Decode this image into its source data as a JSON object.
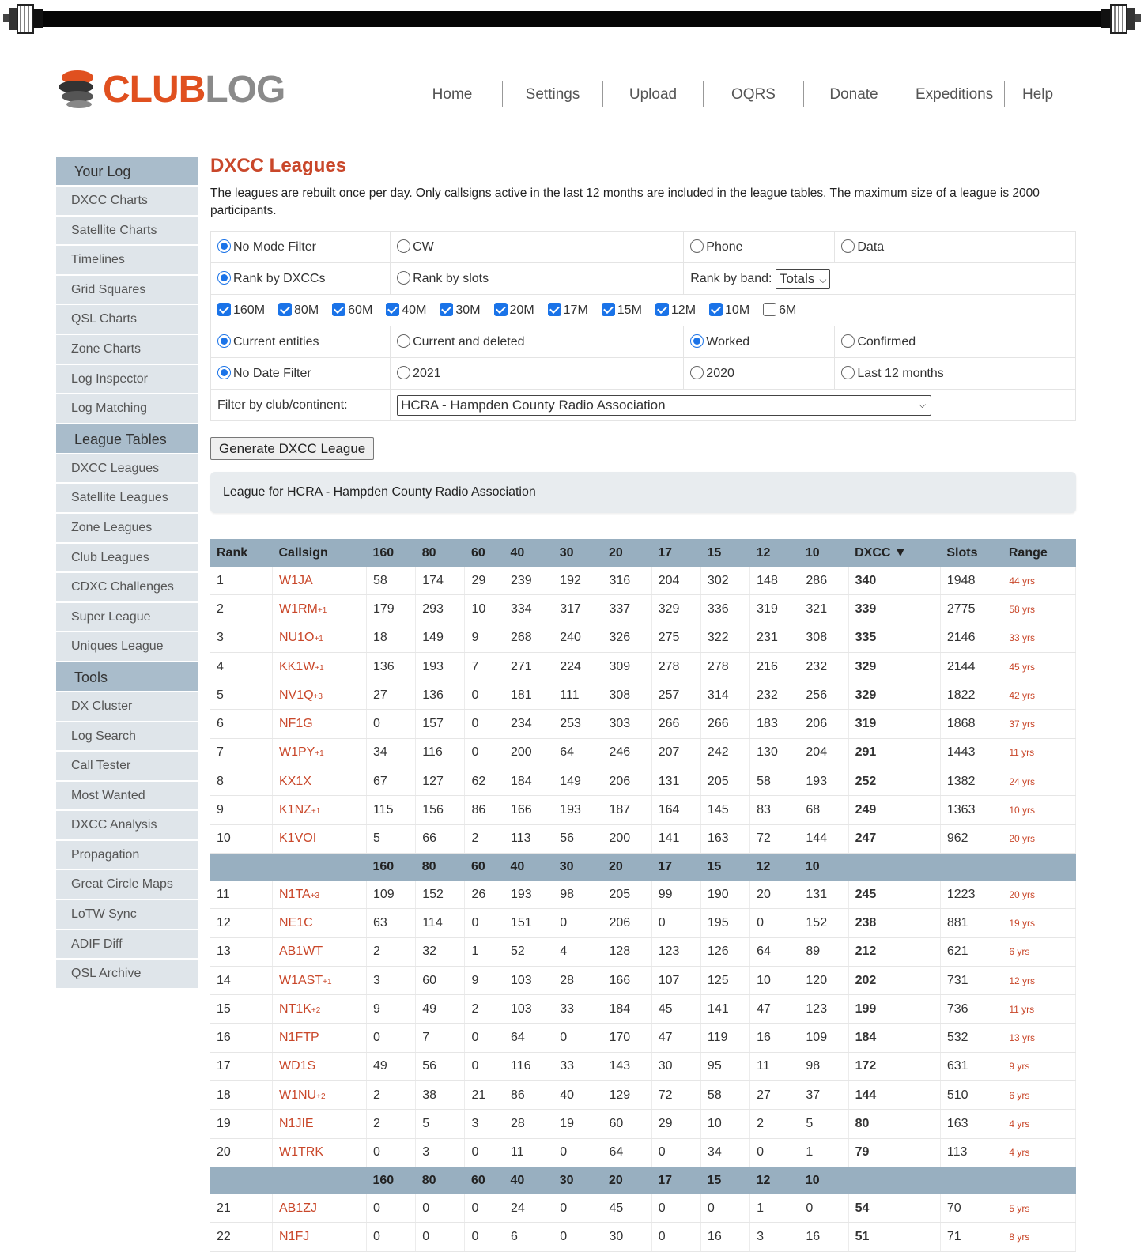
{
  "logo": {
    "club": "CLUB",
    "log": "LOG"
  },
  "nav": [
    "Home",
    "Settings",
    "Upload",
    "OQRS",
    "Donate",
    "Expeditions",
    "Help"
  ],
  "sidebar": [
    {
      "header": "Your Log",
      "items": [
        "DXCC Charts",
        "Satellite Charts",
        "Timelines",
        "Grid Squares",
        "QSL Charts",
        "Zone Charts",
        "Log Inspector",
        "Log Matching"
      ]
    },
    {
      "header": "League Tables",
      "items": [
        "DXCC Leagues",
        "Satellite Leagues",
        "Zone Leagues",
        "Club Leagues",
        "CDXC Challenges",
        "Super League",
        "Uniques League"
      ]
    },
    {
      "header": "Tools",
      "items": [
        "DX Cluster",
        "Log Search",
        "Call Tester",
        "Most Wanted",
        "DXCC Analysis",
        "Propagation",
        "Great Circle Maps",
        "LoTW Sync",
        "ADIF Diff",
        "QSL Archive"
      ]
    }
  ],
  "page": {
    "title": "DXCC Leagues",
    "intro": "The leagues are rebuilt once per day. Only callsigns active in the last 12 months are included in the league tables. The maximum size of a league is 2000 participants."
  },
  "filters": {
    "mode": [
      {
        "label": "No Mode Filter",
        "checked": true
      },
      {
        "label": "CW",
        "checked": false
      },
      {
        "label": "Phone",
        "checked": false
      },
      {
        "label": "Data",
        "checked": false
      }
    ],
    "rank": [
      {
        "label": "Rank by DXCCs",
        "checked": true
      },
      {
        "label": "Rank by slots",
        "checked": false
      }
    ],
    "rank_by_band_label": "Rank by band:",
    "rank_by_band_value": "Totals",
    "bands": [
      {
        "label": "160M",
        "checked": true
      },
      {
        "label": "80M",
        "checked": true
      },
      {
        "label": "60M",
        "checked": true
      },
      {
        "label": "40M",
        "checked": true
      },
      {
        "label": "30M",
        "checked": true
      },
      {
        "label": "20M",
        "checked": true
      },
      {
        "label": "17M",
        "checked": true
      },
      {
        "label": "15M",
        "checked": true
      },
      {
        "label": "12M",
        "checked": true
      },
      {
        "label": "10M",
        "checked": true
      },
      {
        "label": "6M",
        "checked": false
      }
    ],
    "entities": [
      {
        "label": "Current entities",
        "checked": true
      },
      {
        "label": "Current and deleted",
        "checked": false
      },
      {
        "label": "Worked",
        "checked": true
      },
      {
        "label": "Confirmed",
        "checked": false
      }
    ],
    "dates": [
      {
        "label": "No Date Filter",
        "checked": true
      },
      {
        "label": "2021",
        "checked": false
      },
      {
        "label": "2020",
        "checked": false
      },
      {
        "label": "Last 12 months",
        "checked": false
      }
    ],
    "club_label": "Filter by club/continent:",
    "club_value": "HCRA - Hampden County Radio Association"
  },
  "generate_button": "Generate DXCC League",
  "league_caption": "League for HCRA - Hampden County Radio Association",
  "table": {
    "headers": [
      "Rank",
      "Callsign",
      "160",
      "80",
      "60",
      "40",
      "30",
      "20",
      "17",
      "15",
      "12",
      "10",
      "DXCC ▼",
      "Slots",
      "Range"
    ],
    "band_headers": [
      "160",
      "80",
      "60",
      "40",
      "30",
      "20",
      "17",
      "15",
      "12",
      "10"
    ],
    "rows": [
      {
        "rank": "1",
        "call": "W1JA",
        "sfx": "",
        "bands": [
          "58",
          "174",
          "29",
          "239",
          "192",
          "316",
          "204",
          "302",
          "148",
          "286"
        ],
        "dxcc": "340",
        "slots": "1948",
        "range": "44 yrs"
      },
      {
        "rank": "2",
        "call": "W1RM",
        "sfx": "+1",
        "bands": [
          "179",
          "293",
          "10",
          "334",
          "317",
          "337",
          "329",
          "336",
          "319",
          "321"
        ],
        "dxcc": "339",
        "slots": "2775",
        "range": "58 yrs"
      },
      {
        "rank": "3",
        "call": "NU1O",
        "sfx": "+1",
        "bands": [
          "18",
          "149",
          "9",
          "268",
          "240",
          "326",
          "275",
          "322",
          "231",
          "308"
        ],
        "dxcc": "335",
        "slots": "2146",
        "range": "33 yrs"
      },
      {
        "rank": "4",
        "call": "KK1W",
        "sfx": "+1",
        "bands": [
          "136",
          "193",
          "7",
          "271",
          "224",
          "309",
          "278",
          "278",
          "216",
          "232"
        ],
        "dxcc": "329",
        "slots": "2144",
        "range": "45 yrs"
      },
      {
        "rank": "5",
        "call": "NV1Q",
        "sfx": "+3",
        "bands": [
          "27",
          "136",
          "0",
          "181",
          "111",
          "308",
          "257",
          "314",
          "232",
          "256"
        ],
        "dxcc": "329",
        "slots": "1822",
        "range": "42 yrs"
      },
      {
        "rank": "6",
        "call": "NF1G",
        "sfx": "",
        "bands": [
          "0",
          "157",
          "0",
          "234",
          "253",
          "303",
          "266",
          "266",
          "183",
          "206"
        ],
        "dxcc": "319",
        "slots": "1868",
        "range": "37 yrs"
      },
      {
        "rank": "7",
        "call": "W1PY",
        "sfx": "+1",
        "bands": [
          "34",
          "116",
          "0",
          "200",
          "64",
          "246",
          "207",
          "242",
          "130",
          "204"
        ],
        "dxcc": "291",
        "slots": "1443",
        "range": "11 yrs"
      },
      {
        "rank": "8",
        "call": "KX1X",
        "sfx": "",
        "bands": [
          "67",
          "127",
          "62",
          "184",
          "149",
          "206",
          "131",
          "205",
          "58",
          "193"
        ],
        "dxcc": "252",
        "slots": "1382",
        "range": "24 yrs"
      },
      {
        "rank": "9",
        "call": "K1NZ",
        "sfx": "+1",
        "bands": [
          "115",
          "156",
          "86",
          "166",
          "193",
          "187",
          "164",
          "145",
          "83",
          "68"
        ],
        "dxcc": "249",
        "slots": "1363",
        "range": "10 yrs"
      },
      {
        "rank": "10",
        "call": "K1VOI",
        "sfx": "",
        "bands": [
          "5",
          "66",
          "2",
          "113",
          "56",
          "200",
          "141",
          "163",
          "72",
          "144"
        ],
        "dxcc": "247",
        "slots": "962",
        "range": "20 yrs"
      },
      {
        "rank": "11",
        "call": "N1TA",
        "sfx": "+3",
        "bands": [
          "109",
          "152",
          "26",
          "193",
          "98",
          "205",
          "99",
          "190",
          "20",
          "131"
        ],
        "dxcc": "245",
        "slots": "1223",
        "range": "20 yrs"
      },
      {
        "rank": "12",
        "call": "NE1C",
        "sfx": "",
        "bands": [
          "63",
          "114",
          "0",
          "151",
          "0",
          "206",
          "0",
          "195",
          "0",
          "152"
        ],
        "dxcc": "238",
        "slots": "881",
        "range": "19 yrs"
      },
      {
        "rank": "13",
        "call": "AB1WT",
        "sfx": "",
        "bands": [
          "2",
          "32",
          "1",
          "52",
          "4",
          "128",
          "123",
          "126",
          "64",
          "89"
        ],
        "dxcc": "212",
        "slots": "621",
        "range": "6 yrs"
      },
      {
        "rank": "14",
        "call": "W1AST",
        "sfx": "+1",
        "bands": [
          "3",
          "60",
          "9",
          "103",
          "28",
          "166",
          "107",
          "125",
          "10",
          "120"
        ],
        "dxcc": "202",
        "slots": "731",
        "range": "12 yrs"
      },
      {
        "rank": "15",
        "call": "NT1K",
        "sfx": "+2",
        "bands": [
          "9",
          "49",
          "2",
          "103",
          "33",
          "184",
          "45",
          "141",
          "47",
          "123"
        ],
        "dxcc": "199",
        "slots": "736",
        "range": "11 yrs"
      },
      {
        "rank": "16",
        "call": "N1FTP",
        "sfx": "",
        "bands": [
          "0",
          "7",
          "0",
          "64",
          "0",
          "170",
          "47",
          "119",
          "16",
          "109"
        ],
        "dxcc": "184",
        "slots": "532",
        "range": "13 yrs"
      },
      {
        "rank": "17",
        "call": "WD1S",
        "sfx": "",
        "bands": [
          "49",
          "56",
          "0",
          "116",
          "33",
          "143",
          "30",
          "95",
          "11",
          "98"
        ],
        "dxcc": "172",
        "slots": "631",
        "range": "9 yrs"
      },
      {
        "rank": "18",
        "call": "W1NU",
        "sfx": "+2",
        "bands": [
          "2",
          "38",
          "21",
          "86",
          "40",
          "129",
          "72",
          "58",
          "27",
          "37"
        ],
        "dxcc": "144",
        "slots": "510",
        "range": "6 yrs"
      },
      {
        "rank": "19",
        "call": "N1JIE",
        "sfx": "",
        "bands": [
          "2",
          "5",
          "3",
          "28",
          "19",
          "60",
          "29",
          "10",
          "2",
          "5"
        ],
        "dxcc": "80",
        "slots": "163",
        "range": "4 yrs"
      },
      {
        "rank": "20",
        "call": "W1TRK",
        "sfx": "",
        "bands": [
          "0",
          "3",
          "0",
          "11",
          "0",
          "64",
          "0",
          "34",
          "0",
          "1"
        ],
        "dxcc": "79",
        "slots": "113",
        "range": "4 yrs"
      },
      {
        "rank": "21",
        "call": "AB1ZJ",
        "sfx": "",
        "bands": [
          "0",
          "0",
          "0",
          "24",
          "0",
          "45",
          "0",
          "0",
          "1",
          "0"
        ],
        "dxcc": "54",
        "slots": "70",
        "range": "5 yrs"
      },
      {
        "rank": "22",
        "call": "N1FJ",
        "sfx": "",
        "bands": [
          "0",
          "0",
          "0",
          "6",
          "0",
          "30",
          "0",
          "16",
          "3",
          "16"
        ],
        "dxcc": "51",
        "slots": "71",
        "range": "8 yrs"
      }
    ]
  }
}
